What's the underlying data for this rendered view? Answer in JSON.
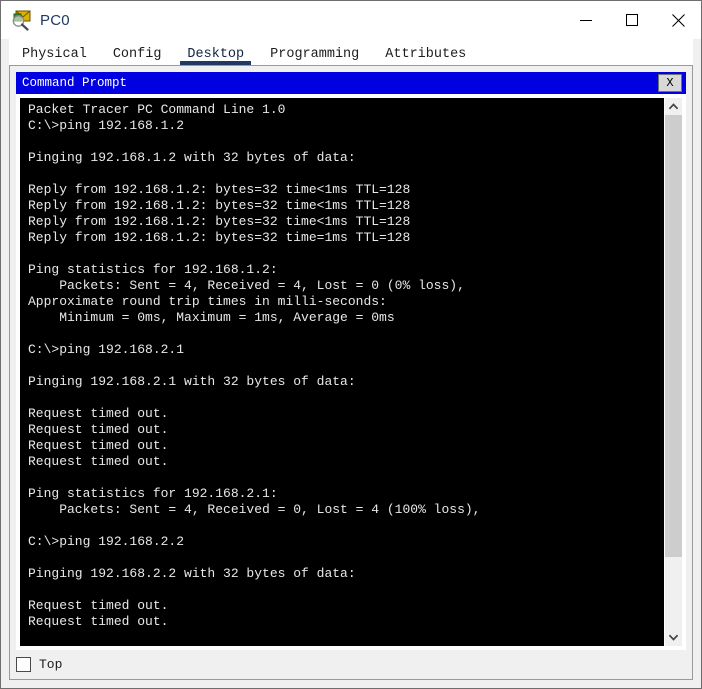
{
  "window": {
    "title": "PC0",
    "icon": "packet-tracer-pc-icon",
    "controls": {
      "minimize": "—",
      "maximize": "□",
      "close": "✕"
    }
  },
  "tabs": [
    {
      "label": "Physical",
      "active": false
    },
    {
      "label": "Config",
      "active": false
    },
    {
      "label": "Desktop",
      "active": true
    },
    {
      "label": "Programming",
      "active": false
    },
    {
      "label": "Attributes",
      "active": false
    }
  ],
  "command_prompt": {
    "title": "Command Prompt",
    "close_label": "X",
    "terminal_text": "Packet Tracer PC Command Line 1.0\nC:\\>ping 192.168.1.2\n\nPinging 192.168.1.2 with 32 bytes of data:\n\nReply from 192.168.1.2: bytes=32 time<1ms TTL=128\nReply from 192.168.1.2: bytes=32 time<1ms TTL=128\nReply from 192.168.1.2: bytes=32 time<1ms TTL=128\nReply from 192.168.1.2: bytes=32 time=1ms TTL=128\n\nPing statistics for 192.168.1.2:\n    Packets: Sent = 4, Received = 4, Lost = 0 (0% loss),\nApproximate round trip times in milli-seconds:\n    Minimum = 0ms, Maximum = 1ms, Average = 0ms\n\nC:\\>ping 192.168.2.1\n\nPinging 192.168.2.1 with 32 bytes of data:\n\nRequest timed out.\nRequest timed out.\nRequest timed out.\nRequest timed out.\n\nPing statistics for 192.168.2.1:\n    Packets: Sent = 4, Received = 0, Lost = 4 (100% loss),\n\nC:\\>ping 192.168.2.2\n\nPinging 192.168.2.2 with 32 bytes of data:\n\nRequest timed out.\nRequest timed out.",
    "scrollbar": {
      "up_arrow": "scroll-up-arrow",
      "down_arrow": "scroll-down-arrow"
    }
  },
  "bottom_bar": {
    "top_checkbox_label": "Top",
    "top_checkbox_checked": false
  },
  "colors": {
    "cmd_titlebar_blue": "#0000e0",
    "terminal_background": "#000000",
    "terminal_text": "#e8e8e8",
    "active_tab_underline": "#1f3864",
    "window_title_text": "#1f3864",
    "panel_background": "#f0f0f0"
  }
}
